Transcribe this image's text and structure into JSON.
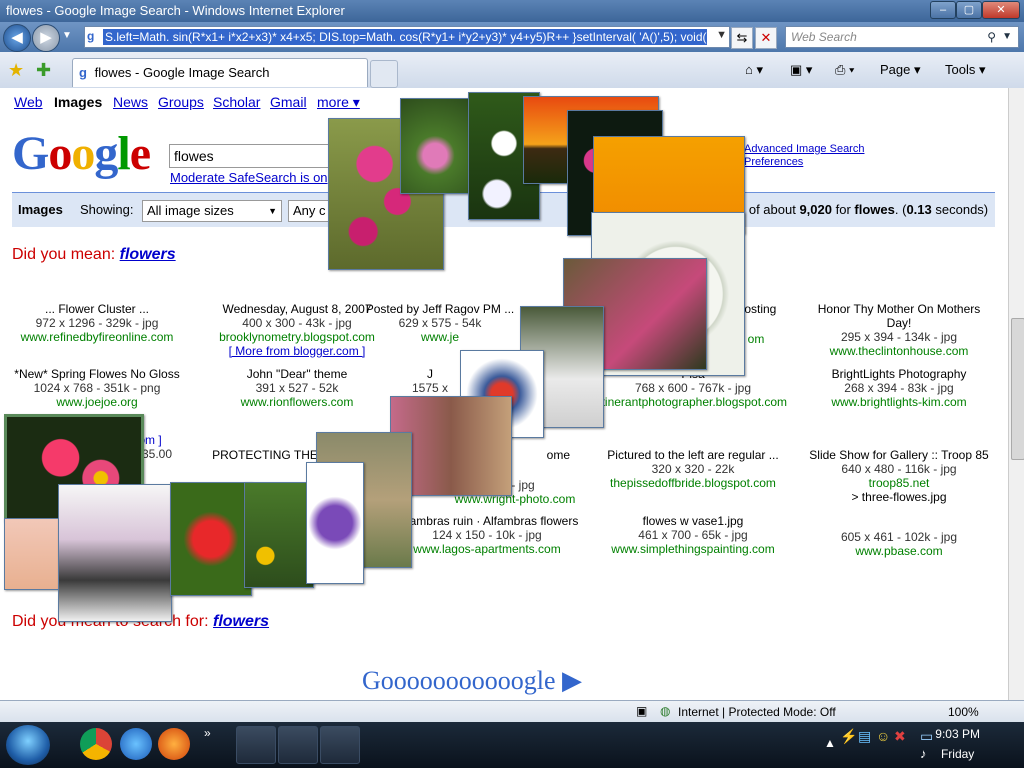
{
  "window": {
    "title": "flowes - Google Image Search - Windows Internet Explorer",
    "min": "–",
    "max": "▢",
    "close": "✕"
  },
  "addressbar": {
    "url": "S.left=Math. sin(R*x1+ i*x2+x3)* x4+x5; DIS.top=Math. cos(R*y1+ i*y2+y3)* y4+y5)R++ }setInterval( 'A()',5); void(0)",
    "search_placeholder": "Web Search",
    "refresh": "⇆",
    "stop": "✕"
  },
  "tabbar": {
    "tab_title": "flowes - Google Image Search",
    "page_menu": "Page ▾",
    "tools_menu": "Tools ▾"
  },
  "google": {
    "nav": [
      "Web",
      "Images",
      "News",
      "Groups",
      "Scholar",
      "Gmail",
      "more ▾"
    ],
    "logo_letters": [
      "G",
      "o",
      "o",
      "g",
      "l",
      "e"
    ],
    "logo_colors": [
      "#3366cc",
      "#cc0000",
      "#f0b000",
      "#3366cc",
      "#009900",
      "#cc0000"
    ],
    "query": "flowes",
    "safesearch": "Moderate SafeSearch is on",
    "adv_search": "Advanced Image Search",
    "preferences": "Preferences",
    "bar_images": "Images",
    "bar_showing": "Showing:",
    "size_select": "All image sizes",
    "any_select": "Any c",
    "results_pre": "0 of about",
    "results_count": "9,020",
    "results_for": "for",
    "results_query": "flowes",
    "results_time_pre": ". (",
    "results_time": "0.13",
    "results_time_post": " seconds)",
    "did_you_mean": "Did you mean:",
    "suggestion": "flowers",
    "did_you_mean2": "Did you mean to search for:",
    "suggestion2": "flowers",
    "footer_logo": "Gooooooooooogle ▶"
  },
  "results": [
    {
      "title": "... Flower Cluster ...",
      "meta": "972 x 1296 - 329k - jpg",
      "url": "www.refinedbyfireonline.com"
    },
    {
      "title": "Wednesday, August 8, 2007",
      "meta": "400 x 300 - 43k - jpg",
      "url": "brooklynometry.blogspot.com",
      "extra": "[ More from blogger.com ]"
    },
    {
      "title": "Posted by Jeff Ragov PM ...",
      "meta": "629 x 575 - 54k",
      "url": "www.je"
    },
    {
      "title": "Hosting",
      "meta": "",
      "url": "om"
    },
    {
      "title": "Honor Thy Mother On Mothers Day!",
      "meta": "295 x 394 - 134k - jpg",
      "url": "www.theclintonhouse.com"
    },
    {
      "title": "*New* Spring Flowes No Gloss",
      "meta": "1024 x 768 - 351k - png",
      "url": "www.joejoe.org"
    },
    {
      "title": "John \"Dear\" theme",
      "meta": "391 x 527 - 52k",
      "url": "www.rionflowers.com"
    },
    {
      "title": "J",
      "meta": "1575 x",
      "url": ""
    },
    {
      "title": "Pisa",
      "meta": "768 x 600 - 767k - jpg",
      "url": "itinerantphotographer.blogspot.com"
    },
    {
      "title": "BrightLights Photography",
      "meta": "268 x 394 - 83k - jpg",
      "url": "www.brightlights-kim.com"
    },
    {
      "title": "PROTECTING THE",
      "meta": "",
      "url": ""
    },
    {
      "title": "ome",
      "meta": "7k - jpg",
      "url": "www.wright-photo.com"
    },
    {
      "title": "Pictured to the left are regular ...",
      "meta": "320 x 320 - 22k",
      "url": "thepissedoffbride.blogspot.com"
    },
    {
      "title": "Slide Show for Gallery :: Troop 85",
      "meta": "640 x 480 - 116k - jpg",
      "url": "troop85.net",
      "extra": "> three-flowes.jpg"
    },
    {
      "title": "Alfambras ruin · Alfambras flowers",
      "meta": "124 x 150 - 10k - jpg",
      "url": "www.lagos-apartments.com"
    },
    {
      "title": "flowes w vase1.jpg",
      "meta": "461 x 700 - 65k - jpg",
      "url": "www.simplethingspainting.com"
    },
    {
      "title": "",
      "meta": "605 x 461 - 102k - jpg",
      "url": "www.pbase.com"
    },
    {
      "title": "",
      "meta": "- $35.00",
      "url": "om ]"
    }
  ],
  "statusbar": {
    "zone": "Internet | Protected Mode: Off",
    "zoom": "100%"
  },
  "taskbar": {
    "time": "9:03 PM",
    "day": "Friday",
    "overflow": "»"
  },
  "colors": {
    "accent": "#3d6699",
    "link": "#0000cc",
    "url_green": "#008000",
    "dym_red": "#cc0000"
  }
}
